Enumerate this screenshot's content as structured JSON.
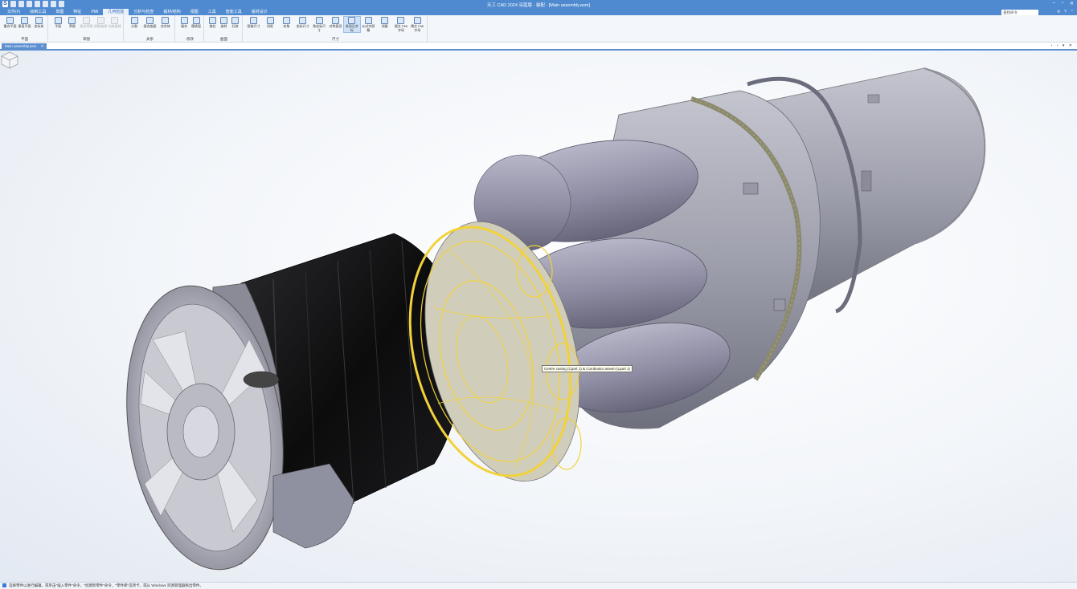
{
  "app": {
    "title": "天工 CAD 2024 深蓝版 - 装配 - [Main assembly.asm]",
    "window_controls": [
      "–",
      "▫",
      "✕"
    ]
  },
  "menu": {
    "tabs": [
      "文件(F)",
      "绘制工具",
      "草图",
      "特征",
      "PMI",
      "几何检验",
      "分析与检查",
      "钣材/结构",
      "视图",
      "工具",
      "智能工具",
      "钣材设计"
    ],
    "active_tab_index": 5,
    "search_placeholder": "查找命令",
    "right_icons": [
      "⟲",
      "?",
      "⌃"
    ]
  },
  "ribbon": {
    "groups": [
      {
        "label": "平面",
        "buttons": [
          "重合平面",
          "垂直平面",
          "坐标系"
        ]
      },
      {
        "label": "草图",
        "buttons": [
          "平面",
          "草图",
          "相关草图",
          "投影曲线",
          "包络面线"
        ]
      },
      {
        "label": "关系",
        "buttons": [
          "分割",
          "接合曲面",
          "合并体"
        ]
      },
      {
        "label": "修改",
        "buttons": [
          "填充",
          "替换面"
        ]
      },
      {
        "label": "曲面",
        "buttons": [
          "拖拉",
          "放样",
          "扫掠"
        ]
      },
      {
        "label": "尺寸",
        "buttons": [
          "智能尺寸",
          "间距",
          "夹角",
          "坐标尺寸",
          "角坐标尺寸",
          "对称直径",
          "发现孔并标",
          "从对齐屏幕",
          "测量",
          "键文 PMI 字母",
          "属文 PMI 字母"
        ]
      }
    ],
    "dim_buttons": [
      "相关草图",
      "投影曲线",
      "包络面线"
    ],
    "selected_button": "发现孔并标"
  },
  "document": {
    "tab_label": "Main assembly.asm",
    "tab_close": "✕",
    "tab_controls": "‹ › ▾ ✕"
  },
  "viewport": {
    "tooltip": "Centre casing (Cpart 1) & Combustor assem (Lpart 1)",
    "highlight_color": "#f2d23a",
    "body_color": "#a7a8b4",
    "casing_color": "#111111"
  },
  "status": {
    "message": "选择零件以进行编辑。或单击\"插入零件\"命令，\"创建新零件\"命令，\"零件库\"选项卡，或从 Windows 资源管理器拖出零件。"
  }
}
